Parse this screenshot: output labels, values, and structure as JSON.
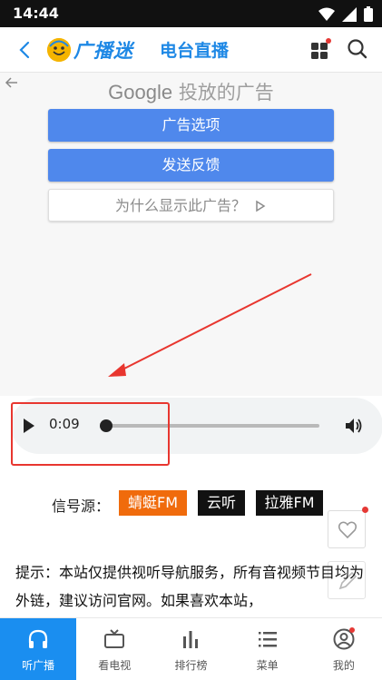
{
  "status_bar": {
    "time": "14:44"
  },
  "header": {
    "logo_text": "广播迷",
    "title": "电台直播"
  },
  "ad": {
    "heading_brand": "Google",
    "heading_text": "投放的广告",
    "buttons": [
      "广告选项",
      "发送反馈"
    ],
    "why_label": "为什么显示此广告？"
  },
  "player": {
    "current_time": "0:09",
    "progress": 0.02
  },
  "signal": {
    "label": "信号源：",
    "sources": [
      "蜻蜓FM",
      "云听",
      "拉雅FM"
    ]
  },
  "notice": {
    "text": "提示：本站仅提供视听导航服务，所有音视频节目均为外链，建议访问官网。如果喜欢本站，"
  },
  "bottom_nav": [
    {
      "label": "听广播",
      "icon": "headphones-icon"
    },
    {
      "label": "看电视",
      "icon": "tv-icon"
    },
    {
      "label": "排行榜",
      "icon": "bar-chart-icon"
    },
    {
      "label": "菜单",
      "icon": "menu-icon"
    },
    {
      "label": "我的",
      "icon": "user-icon"
    }
  ],
  "colors": {
    "accent": "#1a8ef0",
    "ad_blue": "#4f88ec",
    "highlight": "#e8362f",
    "orange": "#f06b0c"
  }
}
